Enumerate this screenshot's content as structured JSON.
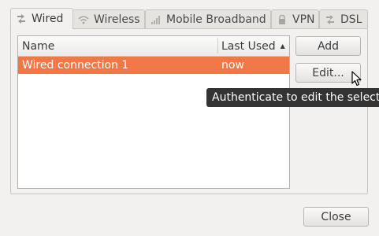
{
  "tabs": [
    {
      "label": "Wired",
      "icon": "wired-network-icon"
    },
    {
      "label": "Wireless",
      "icon": "wireless-icon"
    },
    {
      "label": "Mobile Broadband",
      "icon": "signal-bars-icon"
    },
    {
      "label": "VPN",
      "icon": "lock-icon"
    },
    {
      "label": "DSL",
      "icon": "dsl-icon"
    }
  ],
  "list": {
    "columns": {
      "name": "Name",
      "last_used": "Last Used"
    },
    "sort_indicator": "▲",
    "rows": [
      {
        "name": "Wired connection 1",
        "last_used": "now"
      }
    ]
  },
  "buttons": {
    "add": "Add",
    "edit": "Edit...",
    "close": "Close"
  },
  "tooltip": "Authenticate to edit the selected connection",
  "colors": {
    "selection": "#f07746",
    "tooltip_bg": "#333333"
  }
}
